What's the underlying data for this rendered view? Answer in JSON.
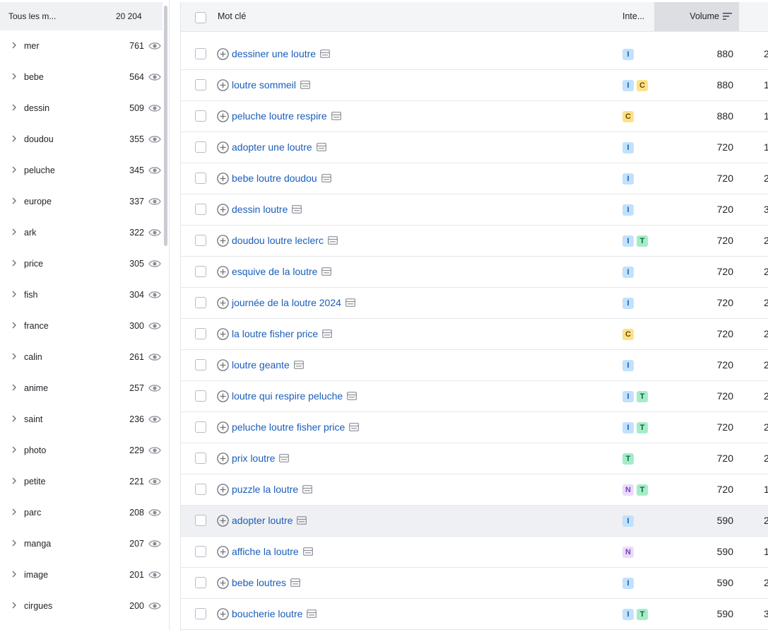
{
  "colors": {
    "link": "#1a5dba",
    "badge_I": "#c2e1fb",
    "badge_I_text": "#1a5dba",
    "badge_C": "#fde18a",
    "badge_C_text": "#6b4a00",
    "badge_T": "#a6ecc9",
    "badge_T_text": "#0a6b3b",
    "badge_N": "#ebdcfb",
    "badge_N_text": "#7a3fc2",
    "highlight_row": "#eff0f3"
  },
  "sidebar": {
    "header_title": "Tous les m...",
    "header_count": "20 204",
    "items": [
      {
        "label": "mer",
        "count": "761"
      },
      {
        "label": "bebe",
        "count": "564"
      },
      {
        "label": "dessin",
        "count": "509"
      },
      {
        "label": "doudou",
        "count": "355"
      },
      {
        "label": "peluche",
        "count": "345"
      },
      {
        "label": "europe",
        "count": "337"
      },
      {
        "label": "ark",
        "count": "322"
      },
      {
        "label": "price",
        "count": "305"
      },
      {
        "label": "fish",
        "count": "304"
      },
      {
        "label": "france",
        "count": "300"
      },
      {
        "label": "calin",
        "count": "261"
      },
      {
        "label": "anime",
        "count": "257"
      },
      {
        "label": "saint",
        "count": "236"
      },
      {
        "label": "photo",
        "count": "229"
      },
      {
        "label": "petite",
        "count": "221"
      },
      {
        "label": "parc",
        "count": "208"
      },
      {
        "label": "manga",
        "count": "207"
      },
      {
        "label": "image",
        "count": "201"
      },
      {
        "label": "cirgues",
        "count": "200"
      }
    ]
  },
  "table": {
    "headers": {
      "keyword": "Mot clé",
      "intent": "Inte...",
      "volume": "Volume"
    },
    "rows": [
      {
        "keyword": "dessiner une loutre",
        "intents": [
          "I"
        ],
        "volume": "880",
        "next": "2",
        "highlighted": false
      },
      {
        "keyword": "loutre sommeil",
        "intents": [
          "I",
          "C"
        ],
        "volume": "880",
        "next": "1",
        "highlighted": false
      },
      {
        "keyword": "peluche loutre respire",
        "intents": [
          "C"
        ],
        "volume": "880",
        "next": "1",
        "highlighted": false
      },
      {
        "keyword": "adopter une loutre",
        "intents": [
          "I"
        ],
        "volume": "720",
        "next": "1",
        "highlighted": false
      },
      {
        "keyword": "bebe loutre doudou",
        "intents": [
          "I"
        ],
        "volume": "720",
        "next": "2",
        "highlighted": false
      },
      {
        "keyword": "dessin loutre",
        "intents": [
          "I"
        ],
        "volume": "720",
        "next": "3",
        "highlighted": false
      },
      {
        "keyword": "doudou loutre leclerc",
        "intents": [
          "I",
          "T"
        ],
        "volume": "720",
        "next": "2",
        "highlighted": false
      },
      {
        "keyword": "esquive de la loutre",
        "intents": [
          "I"
        ],
        "volume": "720",
        "next": "2",
        "highlighted": false
      },
      {
        "keyword": "journée de la loutre 2024",
        "intents": [
          "I"
        ],
        "volume": "720",
        "next": "2",
        "highlighted": false
      },
      {
        "keyword": "la loutre fisher price",
        "intents": [
          "C"
        ],
        "volume": "720",
        "next": "2",
        "highlighted": false
      },
      {
        "keyword": "loutre geante",
        "intents": [
          "I"
        ],
        "volume": "720",
        "next": "2",
        "highlighted": false
      },
      {
        "keyword": "loutre qui respire peluche",
        "intents": [
          "I",
          "T"
        ],
        "volume": "720",
        "next": "2",
        "highlighted": false
      },
      {
        "keyword": "peluche loutre fisher price",
        "intents": [
          "I",
          "T"
        ],
        "volume": "720",
        "next": "2",
        "highlighted": false
      },
      {
        "keyword": "prix loutre",
        "intents": [
          "T"
        ],
        "volume": "720",
        "next": "2",
        "highlighted": false
      },
      {
        "keyword": "puzzle la loutre",
        "intents": [
          "N",
          "T"
        ],
        "volume": "720",
        "next": "1",
        "highlighted": false
      },
      {
        "keyword": "adopter loutre",
        "intents": [
          "I"
        ],
        "volume": "590",
        "next": "2",
        "highlighted": true
      },
      {
        "keyword": "affiche la loutre",
        "intents": [
          "N"
        ],
        "volume": "590",
        "next": "1",
        "highlighted": false
      },
      {
        "keyword": "bebe loutres",
        "intents": [
          "I"
        ],
        "volume": "590",
        "next": "2",
        "highlighted": false
      },
      {
        "keyword": "boucherie loutre",
        "intents": [
          "I",
          "T"
        ],
        "volume": "590",
        "next": "3",
        "highlighted": false
      }
    ]
  }
}
